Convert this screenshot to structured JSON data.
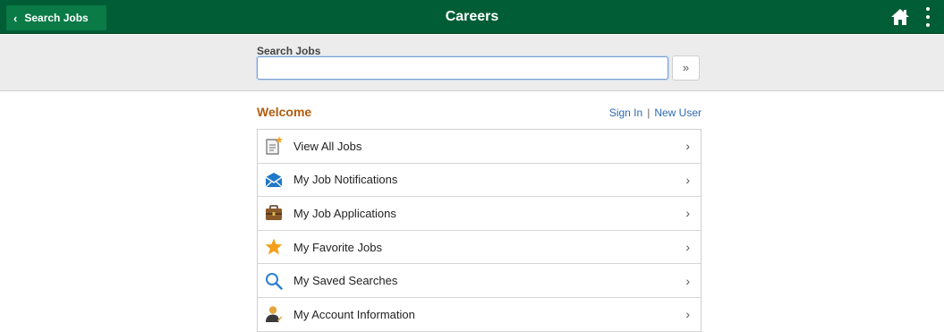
{
  "header": {
    "back_label": "Search Jobs",
    "title": "Careers",
    "brand_color": "#005d35"
  },
  "search": {
    "label": "Search Jobs",
    "value": "",
    "placeholder": "",
    "go_symbol": "»"
  },
  "welcome": {
    "title": "Welcome",
    "sign_in": "Sign In",
    "separator": "|",
    "new_user": "New User"
  },
  "menu": {
    "items": [
      {
        "label": "View All Jobs",
        "icon": "document-star-icon"
      },
      {
        "label": "My Job Notifications",
        "icon": "envelope-icon"
      },
      {
        "label": "My Job Applications",
        "icon": "briefcase-icon"
      },
      {
        "label": "My Favorite Jobs",
        "icon": "star-icon"
      },
      {
        "label": "My Saved Searches",
        "icon": "magnifier-icon"
      },
      {
        "label": "My Account Information",
        "icon": "user-icon"
      }
    ]
  }
}
